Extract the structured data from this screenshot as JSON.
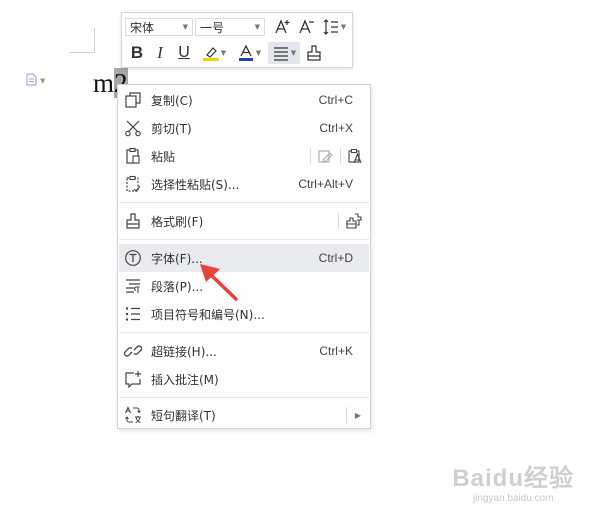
{
  "document": {
    "text_before": "m",
    "text_selected": "2"
  },
  "mini_toolbar": {
    "font_name": "宋体",
    "font_size": "一号",
    "buttons": [
      "bold-icon",
      "italic-icon",
      "underline-icon",
      "highlight-icon",
      "font-color-icon",
      "align-icon",
      "format-painter-icon",
      "grow-font-icon",
      "shrink-font-icon",
      "line-spacing-icon"
    ],
    "highlight_color": "#f2d200",
    "font_color": "#1a3fd6"
  },
  "context_menu": {
    "copy": {
      "label": "复制(C)",
      "shortcut": "Ctrl+C",
      "icon": "copy-icon"
    },
    "cut": {
      "label": "剪切(T)",
      "shortcut": "Ctrl+X",
      "icon": "scissors-icon"
    },
    "paste": {
      "label": "粘贴",
      "icon": "clipboard-icon"
    },
    "paste_special": {
      "label": "选择性粘贴(S)...",
      "shortcut": "Ctrl+Alt+V",
      "icon": "paste-special-icon"
    },
    "format_painter": {
      "label": "格式刷(F)",
      "icon": "brush-icon"
    },
    "font": {
      "label": "字体(F)...",
      "shortcut": "Ctrl+D",
      "icon": "font-t-icon",
      "highlighted": true
    },
    "paragraph": {
      "label": "段落(P)...",
      "icon": "paragraph-icon"
    },
    "bullets": {
      "label": "项目符号和编号(N)...",
      "icon": "bullet-list-icon"
    },
    "hyperlink": {
      "label": "超链接(H)...",
      "shortcut": "Ctrl+K",
      "icon": "link-icon"
    },
    "comment": {
      "label": "插入批注(M)",
      "icon": "comment-icon"
    },
    "translate": {
      "label": "短句翻译(T)",
      "icon": "translate-icon"
    }
  },
  "annotation": {
    "arrow_color": "#e8413a"
  },
  "watermark": {
    "main": "Baidu经验",
    "sub": "jingyan.baidu.com"
  },
  "colors": {
    "menu_hover": "#e9ebef",
    "selection": "#a8a8a8"
  }
}
